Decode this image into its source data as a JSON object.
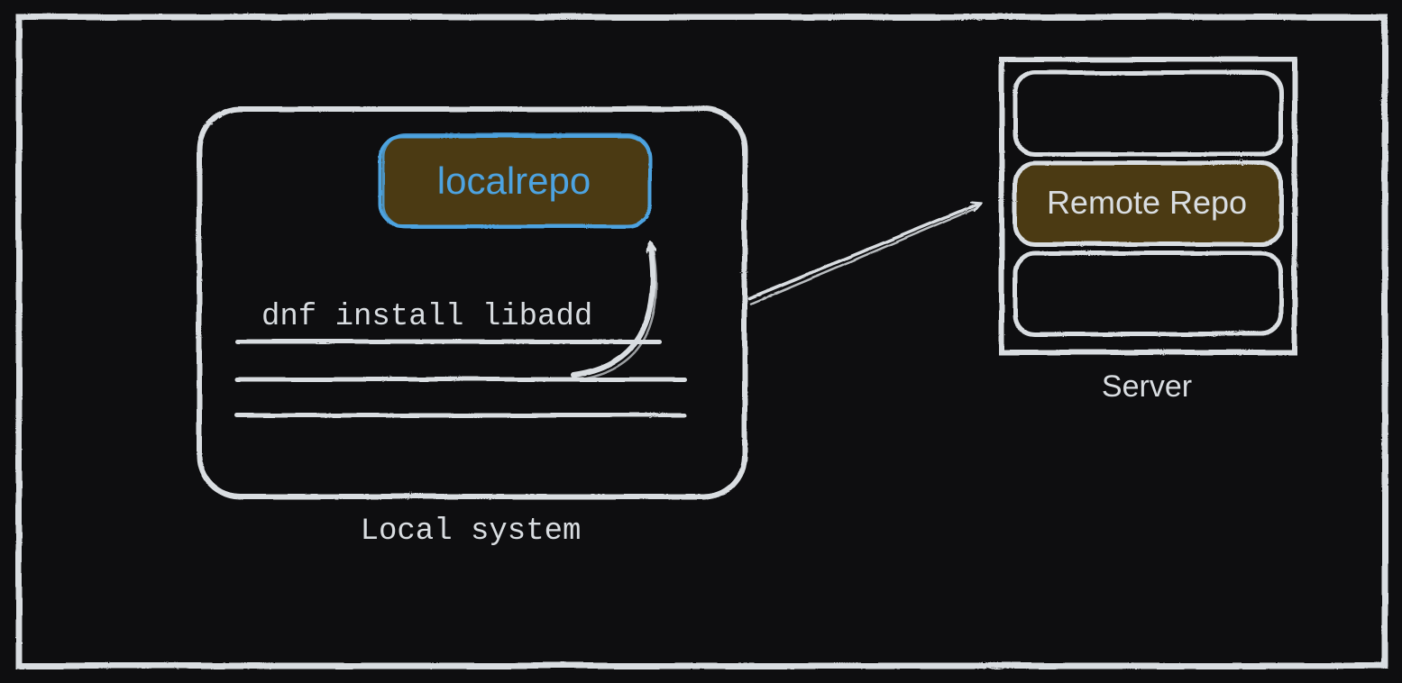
{
  "diagram": {
    "outer_border": true,
    "local_system": {
      "label": "Local system",
      "local_repo_label": "localrepo",
      "command": "dnf install libadd",
      "underlines": 3
    },
    "server": {
      "label": "Server",
      "slots": 3,
      "remote_repo_label": "Remote Repo",
      "remote_repo_slot_index": 1
    },
    "arrows": {
      "command_to_localrepo": true,
      "local_to_server": true
    },
    "colors": {
      "stroke": "#d9dde1",
      "blue": "#4da3e0",
      "fill_brown": "#4b3a13",
      "bg": "#0e0e10"
    }
  }
}
